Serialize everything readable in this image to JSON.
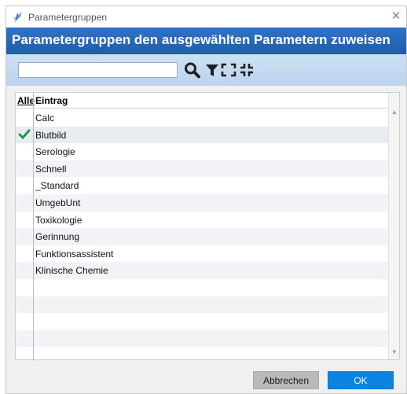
{
  "window": {
    "title": "Parametergruppen",
    "close_glyph": "✕"
  },
  "header": {
    "title": "Parametergruppen den ausgewählten Parametern zuweisen"
  },
  "toolbar": {
    "search_value": "",
    "icons": [
      "search-icon",
      "filter-icon",
      "expand-icon",
      "collapse-icon"
    ]
  },
  "grid": {
    "columns": {
      "all": "Alle",
      "entry": "Eintrag"
    },
    "rows": [
      {
        "label": "Calc",
        "checked": false
      },
      {
        "label": "Blutbild",
        "checked": true
      },
      {
        "label": "Serologie",
        "checked": false
      },
      {
        "label": "Schnell",
        "checked": false
      },
      {
        "label": "_Standard",
        "checked": false
      },
      {
        "label": "UmgebUnt",
        "checked": false
      },
      {
        "label": "Toxikologie",
        "checked": false
      },
      {
        "label": "Gerinnung",
        "checked": false
      },
      {
        "label": "Funktionsassistent",
        "checked": false
      },
      {
        "label": "Klinische Chemie",
        "checked": false
      },
      {
        "label": "",
        "checked": false
      },
      {
        "label": "",
        "checked": false
      },
      {
        "label": "",
        "checked": false
      },
      {
        "label": "",
        "checked": false
      },
      {
        "label": "",
        "checked": false
      }
    ]
  },
  "buttons": {
    "cancel": "Abbrechen",
    "ok": "OK"
  },
  "colors": {
    "header_band": "#2f74c7",
    "toolbar_band": "#c6dbf1",
    "checkmark": "#1e9a3c",
    "ok_button": "#0a84e0",
    "cancel_button": "#b9b9b9"
  }
}
